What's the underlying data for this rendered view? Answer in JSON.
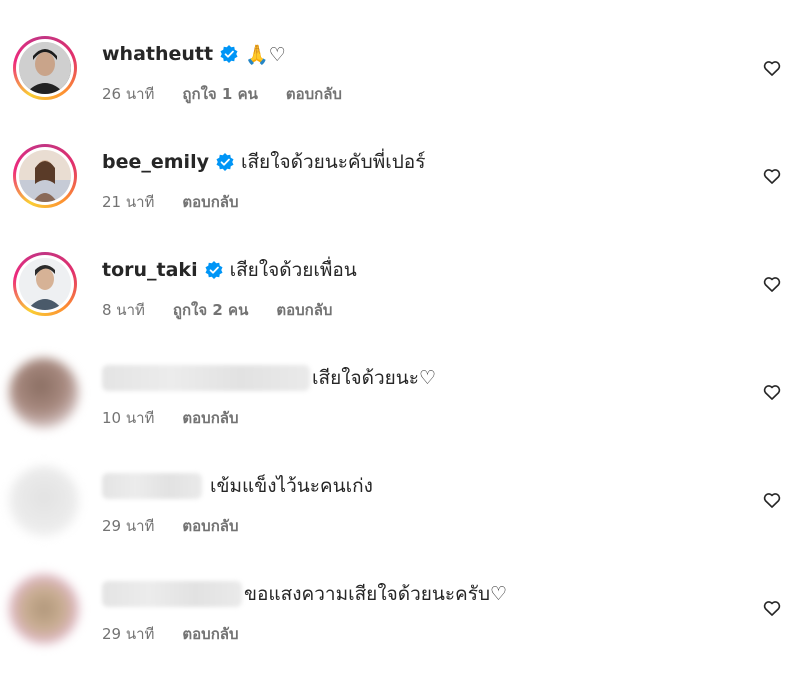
{
  "comments": [
    {
      "username": "whatheutt",
      "verified": true,
      "text": "🙏♡",
      "time": "26 นาที",
      "likes": "ถูกใจ 1 คน",
      "reply": "ตอบกลับ"
    },
    {
      "username": "bee_emily",
      "verified": true,
      "text": "เสียใจด้วยนะคับพี่เปอร์",
      "time": "21 นาที",
      "reply": "ตอบกลับ"
    },
    {
      "username": "toru_taki",
      "verified": true,
      "text": "เสียใจด้วยเพื่อน",
      "time": "8 นาที",
      "likes": "ถูกใจ 2 คน",
      "reply": "ตอบกลับ"
    },
    {
      "username_hidden": true,
      "text": "เสียใจด้วยนะ♡",
      "time": "10 นาที",
      "reply": "ตอบกลับ"
    },
    {
      "username_hidden": true,
      "text": "เข้มแข็งไว้นะคนเก่ง",
      "time": "29 นาที",
      "reply": "ตอบกลับ"
    },
    {
      "username_hidden": true,
      "text": "ขอแสงความเสียใจด้วยนะครับ♡",
      "time": "29 นาที",
      "reply": "ตอบกลับ"
    }
  ],
  "icons": {
    "like": "heart-outline-icon",
    "verified": "verified-badge-icon",
    "pray": "folded-hands-emoji"
  },
  "colors": {
    "verified": "#0095f6",
    "meta_text": "#737373",
    "text": "#262626"
  }
}
